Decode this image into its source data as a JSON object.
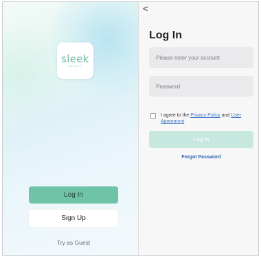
{
  "brand": {
    "logo_text": "sleek",
    "logo_subtext": "SOCKET",
    "accent_color": "#6fc4a8"
  },
  "welcome": {
    "login_label": "Log In",
    "signup_label": "Sign Up",
    "guest_label": "Try as Guest"
  },
  "login_form": {
    "back_icon": "chevron-left-icon",
    "back_glyph": "<",
    "title": "Log In",
    "account_placeholder": "Please enter your account",
    "password_placeholder": "Password",
    "agree_prefix": "I agree to the ",
    "privacy_link": "Privacy Policy",
    "agree_and": " and ",
    "agreement_link": "User Agreement",
    "submit_label": "Log In",
    "forgot_label": "Forgot Password"
  }
}
